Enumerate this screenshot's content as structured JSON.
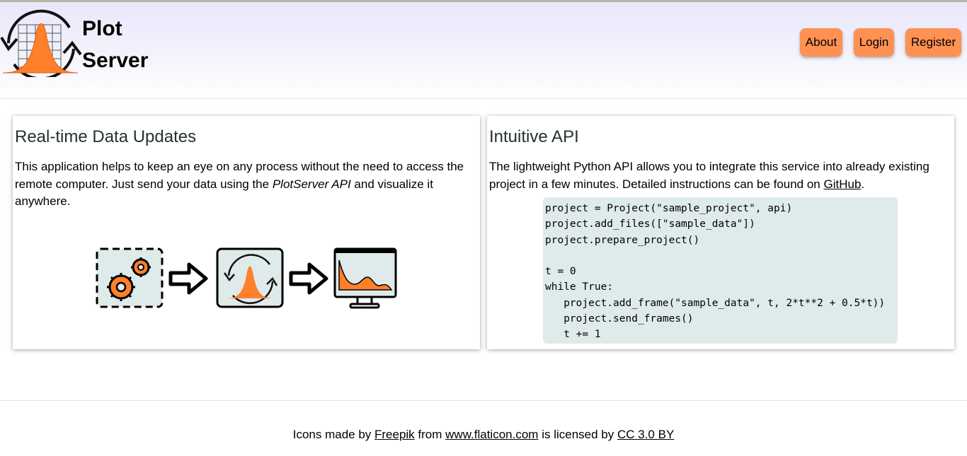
{
  "header": {
    "brand_line1": "Plot",
    "brand_line2": "Server",
    "nav": {
      "about": "About",
      "login": "Login",
      "register": "Register"
    }
  },
  "colors": {
    "accent": "#ff9152",
    "code_bg": "#dfeaea",
    "title_text": "#223333"
  },
  "icons": [
    "plot-server-logo-icon",
    "gears-icon",
    "arrow-right-icon",
    "gaussian-plot-icon",
    "monitor-chart-icon"
  ],
  "left_card": {
    "title": "Real-time Data Updates",
    "text1": "This application helps to keep an eye on any process without the need to access the remote computer. Just send your data using the ",
    "api_name": "PlotServer API",
    "text2": " and visualize it anywhere."
  },
  "right_card": {
    "title": "Intuitive API",
    "text1": "The lightweight Python API allows you to integrate this service into already existing project in a few minutes. Detailed instructions can be found on ",
    "link": "GitHub",
    "text2": ".",
    "code": "project = Project(\"sample_project\", api)\nproject.add_files([\"sample_data\"])\nproject.prepare_project()\n\nt = 0\nwhile True:\n   project.add_frame(\"sample_data\", t, 2*t**2 + 0.5*t))\n   project.send_frames()\n   t += 1"
  },
  "footer": {
    "t1": "Icons made by ",
    "author": "Freepik",
    "t2": " from ",
    "site": "www.flaticon.com",
    "t3": " is licensed by ",
    "license": "CC 3.0 BY"
  }
}
